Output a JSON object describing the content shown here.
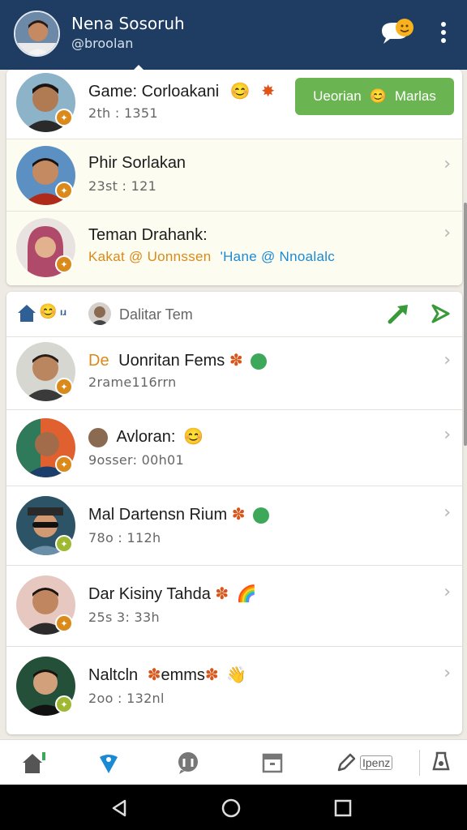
{
  "header": {
    "name": "Nena Sosoruh",
    "handle": "@broolan",
    "accent": "#1f3d63"
  },
  "top_chats": [
    {
      "title": "Game: Corloakani",
      "sub": "2th : 1351",
      "button": {
        "left": "Ueorian",
        "right": "Marlas"
      }
    },
    {
      "title": "Phir Sorlakan",
      "sub": "23st : 121"
    },
    {
      "title": "Teman Drahank:",
      "mentions": {
        "part1": "Kakat @ Uonnssen",
        "part2": "'Hane @ Nnoalalc"
      }
    }
  ],
  "section": {
    "title": "Dalitar Tem"
  },
  "list": [
    {
      "prefix": "De",
      "title": "Uonritan Fems",
      "sub": "2rame116rrn"
    },
    {
      "title": "Avloran:",
      "sub": "9osser: 00h01"
    },
    {
      "title": "Mal Dartensn Rium",
      "sub": "78o : 112h"
    },
    {
      "title": "Dar Kisiny Tahda",
      "sub": "25s 3: 33h"
    },
    {
      "title": "Naltcln",
      "title_suffix": "emms",
      "sub": "2oo : 132nl"
    }
  ],
  "nav": {
    "compose_label": "Iрenz"
  },
  "colors": {
    "green": "#6bb452",
    "orange": "#d98a1a",
    "blue": "#1a8ad4"
  }
}
